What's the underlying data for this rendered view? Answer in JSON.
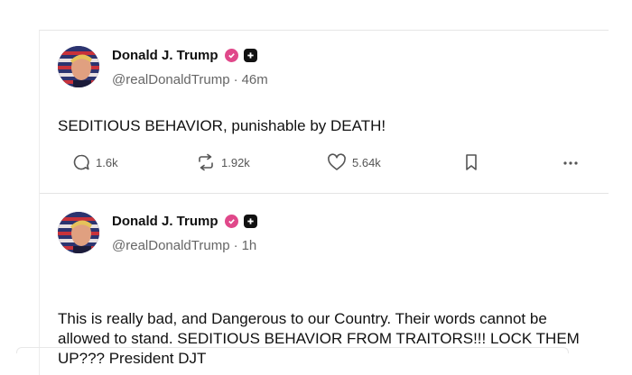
{
  "posts": [
    {
      "author": "Donald J. Trump",
      "handle": "@realDonaldTrump",
      "time": "46m",
      "text": "SEDITIOUS BEHAVIOR, punishable by DEATH!",
      "replies": "1.6k",
      "reposts": "1.92k",
      "likes": "5.64k"
    },
    {
      "author": "Donald J. Trump",
      "handle": "@realDonaldTrump",
      "time": "1h",
      "text": "This is really bad, and Dangerous to our Country. Their words cannot be allowed to stand. SEDITIOUS BEHAVIOR FROM TRAITORS!!! LOCK THEM UP??? President DJT"
    }
  ],
  "separator": "·",
  "icons": {
    "reply": "reply-icon",
    "repost": "repost-icon",
    "like": "heart-icon",
    "bookmark": "bookmark-icon",
    "more": "more-icon",
    "verified": "verified-badge-icon",
    "plus": "plus-badge-icon"
  },
  "colors": {
    "verified": "#e0488a",
    "muted": "#666666",
    "divider": "#e4e4e4"
  }
}
